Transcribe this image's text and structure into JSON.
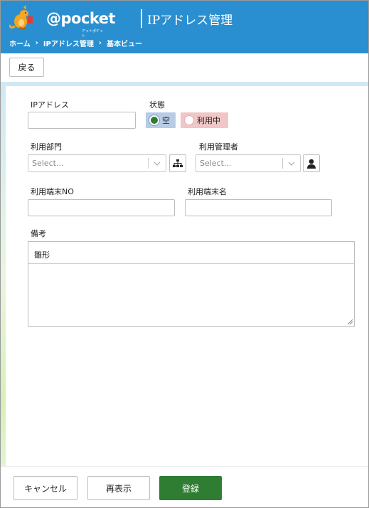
{
  "header": {
    "logo_text": "@pocket",
    "logo_sub": "アットポケット",
    "title": "IPアドレス管理",
    "bg_color": "#2a8fd0"
  },
  "breadcrumb": [
    "ホーム",
    "IPアドレス管理",
    "基本ビュー"
  ],
  "toolbar": {
    "back_label": "戻る"
  },
  "form": {
    "ip_label": "IPアドレス",
    "ip_value": "",
    "state_label": "状態",
    "state_options": [
      {
        "label": "空",
        "selected": true,
        "bg": "#b9cce6",
        "dot": "#2e7d32"
      },
      {
        "label": "利用中",
        "selected": false,
        "bg": "#f0c6c6",
        "dot": "#ffffff"
      }
    ],
    "dept_label": "利用部門",
    "dept_placeholder": "Select...",
    "dept_icon": "org-chart-icon",
    "admin_label": "利用管理者",
    "admin_placeholder": "Select...",
    "admin_icon": "user-icon",
    "terminal_no_label": "利用端末NO",
    "terminal_no_value": "",
    "terminal_name_label": "利用端末名",
    "terminal_name_value": "",
    "remarks_label": "備考",
    "remarks_template": "雛形",
    "remarks_value": ""
  },
  "footer": {
    "cancel_label": "キャンセル",
    "refresh_label": "再表示",
    "submit_label": "登録",
    "submit_color": "#2e7d32"
  }
}
